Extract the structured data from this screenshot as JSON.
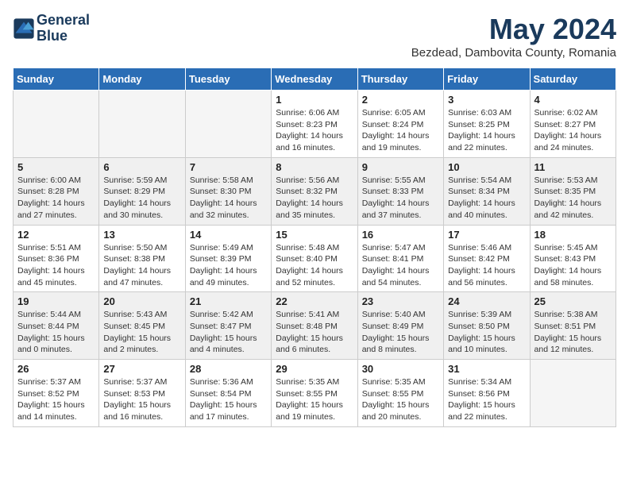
{
  "logo": {
    "line1": "General",
    "line2": "Blue"
  },
  "title": "May 2024",
  "subtitle": "Bezdead, Dambovita County, Romania",
  "headers": [
    "Sunday",
    "Monday",
    "Tuesday",
    "Wednesday",
    "Thursday",
    "Friday",
    "Saturday"
  ],
  "weeks": [
    [
      {
        "day": "",
        "info": ""
      },
      {
        "day": "",
        "info": ""
      },
      {
        "day": "",
        "info": ""
      },
      {
        "day": "1",
        "info": "Sunrise: 6:06 AM\nSunset: 8:23 PM\nDaylight: 14 hours\nand 16 minutes."
      },
      {
        "day": "2",
        "info": "Sunrise: 6:05 AM\nSunset: 8:24 PM\nDaylight: 14 hours\nand 19 minutes."
      },
      {
        "day": "3",
        "info": "Sunrise: 6:03 AM\nSunset: 8:25 PM\nDaylight: 14 hours\nand 22 minutes."
      },
      {
        "day": "4",
        "info": "Sunrise: 6:02 AM\nSunset: 8:27 PM\nDaylight: 14 hours\nand 24 minutes."
      }
    ],
    [
      {
        "day": "5",
        "info": "Sunrise: 6:00 AM\nSunset: 8:28 PM\nDaylight: 14 hours\nand 27 minutes."
      },
      {
        "day": "6",
        "info": "Sunrise: 5:59 AM\nSunset: 8:29 PM\nDaylight: 14 hours\nand 30 minutes."
      },
      {
        "day": "7",
        "info": "Sunrise: 5:58 AM\nSunset: 8:30 PM\nDaylight: 14 hours\nand 32 minutes."
      },
      {
        "day": "8",
        "info": "Sunrise: 5:56 AM\nSunset: 8:32 PM\nDaylight: 14 hours\nand 35 minutes."
      },
      {
        "day": "9",
        "info": "Sunrise: 5:55 AM\nSunset: 8:33 PM\nDaylight: 14 hours\nand 37 minutes."
      },
      {
        "day": "10",
        "info": "Sunrise: 5:54 AM\nSunset: 8:34 PM\nDaylight: 14 hours\nand 40 minutes."
      },
      {
        "day": "11",
        "info": "Sunrise: 5:53 AM\nSunset: 8:35 PM\nDaylight: 14 hours\nand 42 minutes."
      }
    ],
    [
      {
        "day": "12",
        "info": "Sunrise: 5:51 AM\nSunset: 8:36 PM\nDaylight: 14 hours\nand 45 minutes."
      },
      {
        "day": "13",
        "info": "Sunrise: 5:50 AM\nSunset: 8:38 PM\nDaylight: 14 hours\nand 47 minutes."
      },
      {
        "day": "14",
        "info": "Sunrise: 5:49 AM\nSunset: 8:39 PM\nDaylight: 14 hours\nand 49 minutes."
      },
      {
        "day": "15",
        "info": "Sunrise: 5:48 AM\nSunset: 8:40 PM\nDaylight: 14 hours\nand 52 minutes."
      },
      {
        "day": "16",
        "info": "Sunrise: 5:47 AM\nSunset: 8:41 PM\nDaylight: 14 hours\nand 54 minutes."
      },
      {
        "day": "17",
        "info": "Sunrise: 5:46 AM\nSunset: 8:42 PM\nDaylight: 14 hours\nand 56 minutes."
      },
      {
        "day": "18",
        "info": "Sunrise: 5:45 AM\nSunset: 8:43 PM\nDaylight: 14 hours\nand 58 minutes."
      }
    ],
    [
      {
        "day": "19",
        "info": "Sunrise: 5:44 AM\nSunset: 8:44 PM\nDaylight: 15 hours\nand 0 minutes."
      },
      {
        "day": "20",
        "info": "Sunrise: 5:43 AM\nSunset: 8:45 PM\nDaylight: 15 hours\nand 2 minutes."
      },
      {
        "day": "21",
        "info": "Sunrise: 5:42 AM\nSunset: 8:47 PM\nDaylight: 15 hours\nand 4 minutes."
      },
      {
        "day": "22",
        "info": "Sunrise: 5:41 AM\nSunset: 8:48 PM\nDaylight: 15 hours\nand 6 minutes."
      },
      {
        "day": "23",
        "info": "Sunrise: 5:40 AM\nSunset: 8:49 PM\nDaylight: 15 hours\nand 8 minutes."
      },
      {
        "day": "24",
        "info": "Sunrise: 5:39 AM\nSunset: 8:50 PM\nDaylight: 15 hours\nand 10 minutes."
      },
      {
        "day": "25",
        "info": "Sunrise: 5:38 AM\nSunset: 8:51 PM\nDaylight: 15 hours\nand 12 minutes."
      }
    ],
    [
      {
        "day": "26",
        "info": "Sunrise: 5:37 AM\nSunset: 8:52 PM\nDaylight: 15 hours\nand 14 minutes."
      },
      {
        "day": "27",
        "info": "Sunrise: 5:37 AM\nSunset: 8:53 PM\nDaylight: 15 hours\nand 16 minutes."
      },
      {
        "day": "28",
        "info": "Sunrise: 5:36 AM\nSunset: 8:54 PM\nDaylight: 15 hours\nand 17 minutes."
      },
      {
        "day": "29",
        "info": "Sunrise: 5:35 AM\nSunset: 8:55 PM\nDaylight: 15 hours\nand 19 minutes."
      },
      {
        "day": "30",
        "info": "Sunrise: 5:35 AM\nSunset: 8:55 PM\nDaylight: 15 hours\nand 20 minutes."
      },
      {
        "day": "31",
        "info": "Sunrise: 5:34 AM\nSunset: 8:56 PM\nDaylight: 15 hours\nand 22 minutes."
      },
      {
        "day": "",
        "info": ""
      }
    ]
  ]
}
